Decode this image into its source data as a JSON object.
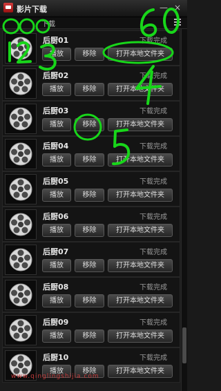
{
  "window": {
    "title": "影片下载"
  },
  "toolbar": {
    "tab": "下载"
  },
  "icons": {
    "logo": "film-logo-icon",
    "minimize": "minimize-icon",
    "close": "close-icon",
    "menu": "menu-icon",
    "thumb": "film-reel-icon"
  },
  "controls": {
    "minimize_glyph": "—",
    "close_glyph": "×"
  },
  "list": {
    "items": [
      {
        "title": "后厨01",
        "status": "下载完成",
        "play": "播放",
        "remove": "移除",
        "open": "打开本地文件夹"
      },
      {
        "title": "后厨02",
        "status": "下载完成",
        "play": "播放",
        "remove": "移除",
        "open": "打开本地文件夹"
      },
      {
        "title": "后厨03",
        "status": "下载完成",
        "play": "播放",
        "remove": "移除",
        "open": "打开本地文件夹"
      },
      {
        "title": "后厨04",
        "status": "下载完成",
        "play": "播放",
        "remove": "移除",
        "open": "打开本地文件夹"
      },
      {
        "title": "后厨05",
        "status": "下载完成",
        "play": "播放",
        "remove": "移除",
        "open": "打开本地文件夹"
      },
      {
        "title": "后厨06",
        "status": "下载完成",
        "play": "播放",
        "remove": "移除",
        "open": "打开本地文件夹"
      },
      {
        "title": "后厨07",
        "status": "下载完成",
        "play": "播放",
        "remove": "移除",
        "open": "打开本地文件夹"
      },
      {
        "title": "后厨08",
        "status": "下载完成",
        "play": "播放",
        "remove": "移除",
        "open": "打开本地文件夹"
      },
      {
        "title": "后厨09",
        "status": "下载完成",
        "play": "播放",
        "remove": "移除",
        "open": "打开本地文件夹"
      },
      {
        "title": "后厨10",
        "status": "下载完成",
        "play": "播放",
        "remove": "移除",
        "open": "打开本地文件夹"
      }
    ]
  },
  "watermark": "www.qinglingshijia.com",
  "annotations": {
    "color": "#18d61a",
    "labels": [
      "1",
      "2",
      "3",
      "4",
      "5",
      "6",
      "0"
    ]
  }
}
